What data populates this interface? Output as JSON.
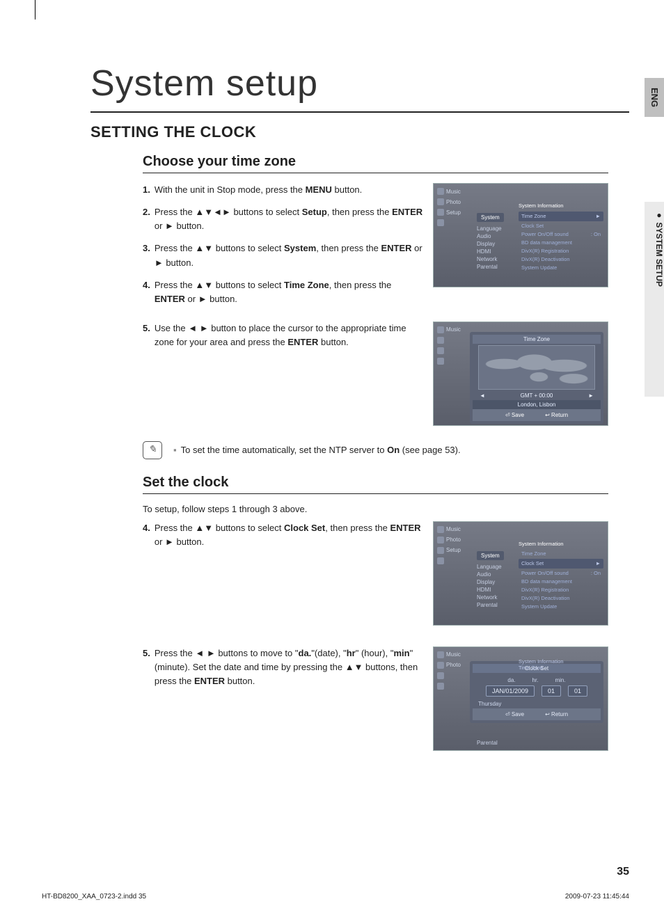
{
  "title": "System setup",
  "section": "SETTING THE CLOCK",
  "side_lang": "ENG",
  "side_tab": "●  SYSTEM SETUP",
  "sub1": {
    "heading": "Choose your time zone",
    "steps": [
      {
        "n": "1.",
        "pre": "With the unit in Stop mode, press the ",
        "b1": "MENU",
        "post": " button."
      },
      {
        "n": "2.",
        "pre": "Press the ▲▼◄► buttons to select ",
        "b1": "Setup",
        "mid": ", then press the ",
        "b2": "ENTER",
        "post": " or ► button."
      },
      {
        "n": "3.",
        "pre": "Press the ▲▼ buttons to select ",
        "b1": "System",
        "mid": ", then press the ",
        "b2": "ENTER",
        "post": " or ► button."
      },
      {
        "n": "4.",
        "pre": "Press the ▲▼ buttons to select ",
        "b1": "Time Zone",
        "mid": ", then press the ",
        "b2": "ENTER",
        "post": " or ► button."
      },
      {
        "n": "5.",
        "pre": "Use the ◄ ► button to place the cursor to the appropriate time zone for your area and press the ",
        "b1": "ENTER",
        "post": " button."
      }
    ],
    "menu": {
      "left": [
        "Music",
        "Photo",
        "Setup"
      ],
      "col": {
        "highlight": "System",
        "items": [
          "Language",
          "Audio",
          "Display",
          "HDMI",
          "Network",
          "Parental"
        ]
      },
      "right": {
        "head": "System Information",
        "rows": [
          {
            "label": "Time Zone",
            "val": "►",
            "hl": true
          },
          {
            "label": "Clock Set",
            "val": ""
          },
          {
            "label": "Power On/Off sound",
            "val": ": On"
          },
          {
            "label": "BD data management",
            "val": ""
          },
          {
            "label": "DivX(R) Registration",
            "val": ""
          },
          {
            "label": "DivX(R) Deactivation",
            "val": ""
          },
          {
            "label": "System Update",
            "val": ""
          }
        ]
      }
    },
    "map": {
      "title": "Time Zone",
      "gmt": "GMT + 00:00",
      "city": "London, Lisbon",
      "save": "Save",
      "ret": "Return"
    }
  },
  "note": {
    "pre": "To set the time automatically, set the NTP server to ",
    "b": "On",
    "post": " (see page 53)."
  },
  "sub2": {
    "heading": "Set the clock",
    "intro": "To setup, follow steps 1 through 3 above.",
    "steps": [
      {
        "n": "4.",
        "pre": "Press the ▲▼ buttons to select ",
        "b1": "Clock Set",
        "mid": ", then press the ",
        "b2": "ENTER",
        "post": " or ► button."
      },
      {
        "n": "5.",
        "pre": "Press the ◄ ► buttons to move to \"",
        "b1": "da.",
        "mid1": "\"(date), \"",
        "b2": "hr",
        "mid2": "\" (hour), \"",
        "b3": "min",
        "mid3": "\" (minute). Set the date and time by pressing the ▲▼ buttons, then press the ",
        "b4": "ENTER",
        "post": " button."
      }
    ],
    "menu": {
      "left": [
        "Music",
        "Photo",
        "Setup"
      ],
      "col": {
        "highlight": "System",
        "items": [
          "Language",
          "Audio",
          "Display",
          "HDMI",
          "Network",
          "Parental"
        ]
      },
      "right": {
        "head": "System Information",
        "rows": [
          {
            "label": "Time Zone",
            "val": ""
          },
          {
            "label": "Clock Set",
            "val": "►",
            "hl": true
          },
          {
            "label": "Power On/Off sound",
            "val": ": On"
          },
          {
            "label": "BD data management",
            "val": ""
          },
          {
            "label": "DivX(R) Registration",
            "val": ""
          },
          {
            "label": "DivX(R) Deactivation",
            "val": ""
          },
          {
            "label": "System Update",
            "val": ""
          }
        ]
      }
    },
    "clockset": {
      "title": "Clock Set",
      "labels": [
        "da.",
        "hr.",
        "min."
      ],
      "vals": [
        "JAN/01/2009",
        "01",
        "01"
      ],
      "day": "Thursday",
      "save": "Save",
      "ret": "Return",
      "parental": "Parental",
      "head_above": "System Information",
      "tz_above": "Time Zone"
    }
  },
  "pagenum": "35",
  "footer_left": "HT-BD8200_XAA_0723-2.indd   35",
  "footer_right": "2009-07-23     11:45:44"
}
